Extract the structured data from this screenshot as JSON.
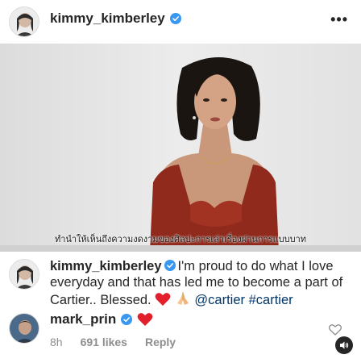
{
  "post": {
    "author": "kimmy_kimberley",
    "more_label": "•••",
    "video_subtitle": "ทำนำให้เห็นถึงความงดงามของศิลปะการเล่าเรื่องผ่านการแบบบาท"
  },
  "caption": {
    "username": "kimmy_kimberley",
    "text": "I'm proud to do what I love everyday and that has led me to become a part of Cartier.. Blessed.",
    "mention": "@cartier",
    "hashtag": "#cartier"
  },
  "comment": {
    "username": "mark_prin",
    "time": "8h",
    "likes": "691 likes",
    "reply_label": "Reply"
  },
  "colors": {
    "verified": "#3897f0",
    "heart": "#ed4956",
    "link": "#00376b",
    "muted": "#8e8e8e"
  },
  "icons": [
    "verified-badge-icon",
    "more-options-icon",
    "heart-emoji-icon",
    "praying-hands-emoji-icon",
    "like-heart-icon",
    "sound-toggle-icon"
  ]
}
